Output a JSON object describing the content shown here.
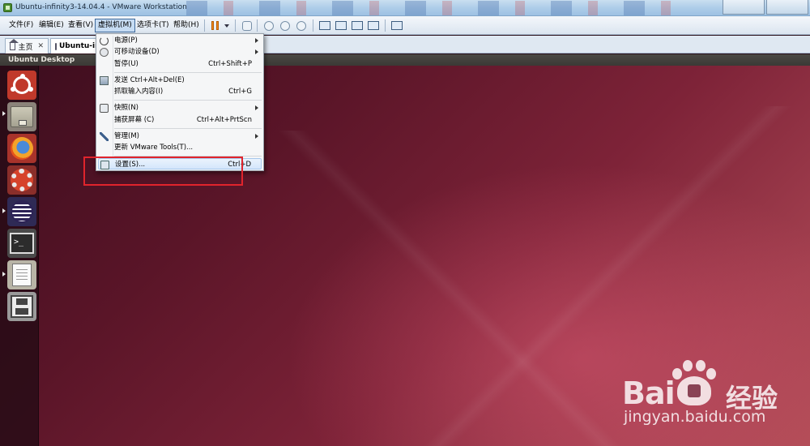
{
  "window": {
    "title": "Ubuntu-infinity3-14.04.4 - VMware Workstation"
  },
  "menubar": {
    "items": [
      {
        "label": "文件(F)"
      },
      {
        "label": "编辑(E)"
      },
      {
        "label": "查看(V)"
      },
      {
        "label": "虚拟机(M)",
        "active": true
      },
      {
        "label": "选项卡(T)"
      },
      {
        "label": "帮助(H)"
      }
    ]
  },
  "tabs": [
    {
      "label": "主页",
      "icon": "home-icon"
    },
    {
      "label": "Ubuntu-inf",
      "icon": "vm-icon",
      "selected": true
    }
  ],
  "vm": {
    "desktop_label": "Ubuntu Desktop"
  },
  "launcher": {
    "icons": [
      "ubuntu-dash-icon",
      "files-icon",
      "firefox-icon",
      "system-settings-icon",
      "eclipse-icon",
      "terminal-icon",
      "text-editor-icon",
      "save-icon"
    ]
  },
  "dropdown": {
    "items": [
      {
        "label": "电源(P)",
        "shortcut": "",
        "submenu": true,
        "icon": "power-icon"
      },
      {
        "label": "可移动设备(D)",
        "shortcut": "",
        "submenu": true,
        "icon": "removable-device-icon"
      },
      {
        "label": "暂停(U)",
        "shortcut": "Ctrl+Shift+P",
        "submenu": false,
        "icon": ""
      },
      {
        "label": "发送 Ctrl+Alt+Del(E)",
        "shortcut": "",
        "submenu": false,
        "icon": "send-keys-icon"
      },
      {
        "label": "抓取输入内容(I)",
        "shortcut": "Ctrl+G",
        "submenu": false,
        "icon": ""
      },
      {
        "label": "快照(N)",
        "shortcut": "",
        "submenu": true,
        "icon": "snapshot-icon"
      },
      {
        "label": "捕获屏幕 (C)",
        "shortcut": "Ctrl+Alt+PrtScn",
        "submenu": false,
        "icon": ""
      },
      {
        "label": "管理(M)",
        "shortcut": "",
        "submenu": true,
        "icon": "wrench-icon"
      },
      {
        "label": "更新 VMware Tools(T)...",
        "shortcut": "",
        "submenu": false,
        "icon": ""
      },
      {
        "label": "设置(S)...",
        "shortcut": "Ctrl+D",
        "submenu": false,
        "icon": "settings-icon",
        "highlighted": true
      }
    ]
  },
  "watermark": {
    "brand_latin": "Bai",
    "brand_latin_suffix": "",
    "brand_cn": "经验",
    "url": "jingyan.baidu.com"
  },
  "colors": {
    "highlight_box": "#e0242c",
    "pause_icon": "#f28a1b"
  }
}
